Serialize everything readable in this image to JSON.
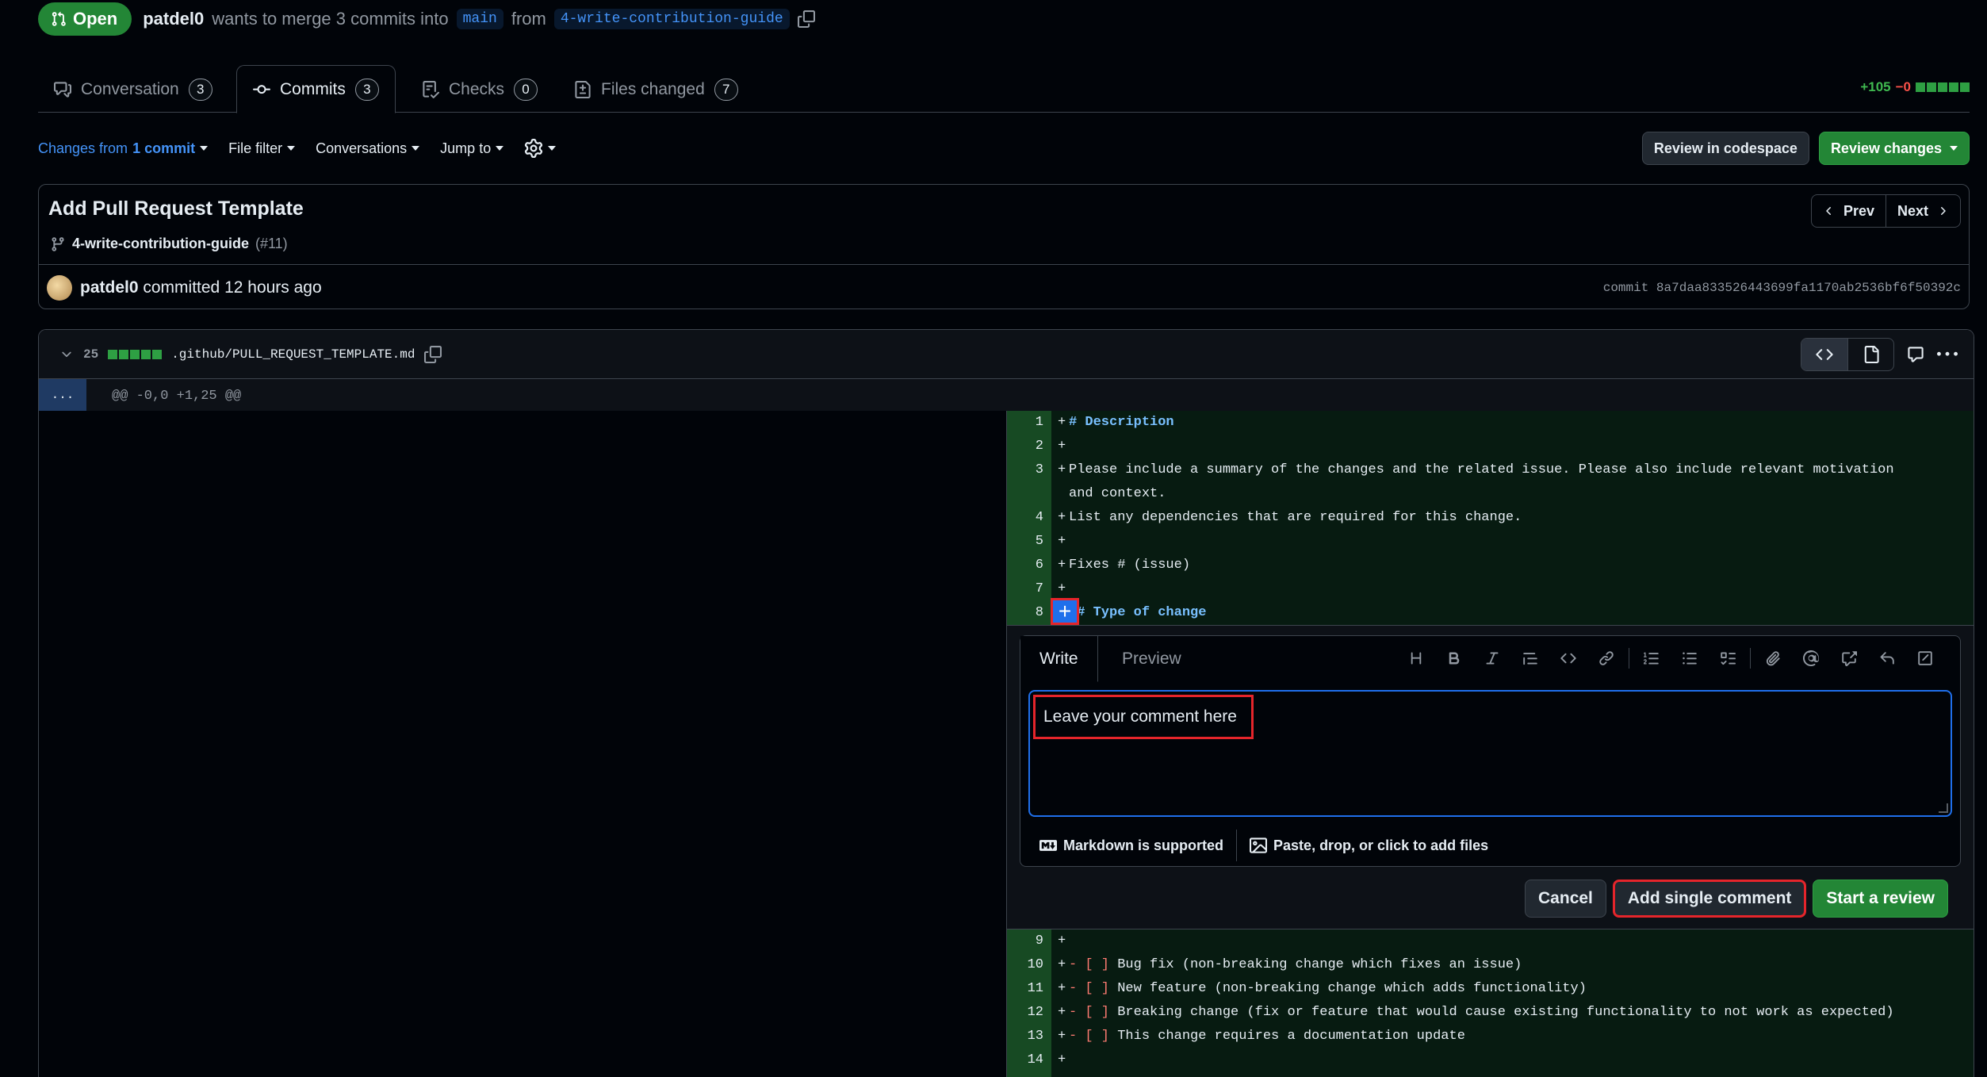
{
  "pr": {
    "state": "Open",
    "author": "patdel0",
    "merge_text": "wants to merge 3 commits into",
    "base": "main",
    "from_text": "from",
    "head": "4-write-contribution-guide"
  },
  "tabs": [
    {
      "label": "Conversation",
      "count": "3"
    },
    {
      "label": "Commits",
      "count": "3"
    },
    {
      "label": "Checks",
      "count": "0"
    },
    {
      "label": "Files changed",
      "count": "7"
    }
  ],
  "diffstat": {
    "additions": "+105",
    "deletions": "−0"
  },
  "toolbar": {
    "changes_from": "Changes from",
    "commit_count": "1 commit",
    "file_filter": "File filter",
    "conversations": "Conversations",
    "jump_to": "Jump to",
    "review_codespace": "Review in codespace",
    "review_changes": "Review changes"
  },
  "commit": {
    "title": "Add Pull Request Template",
    "branch": "4-write-contribution-guide",
    "pr_ref": "(#11)",
    "prev": "Prev",
    "next": "Next",
    "author": "patdel0",
    "committed": "committed 12 hours ago",
    "sha_label": "commit 8a7daa833526443699fa1170ab2536bf6f50392c"
  },
  "file": {
    "change_count": "25",
    "filename": ".github/PULL_REQUEST_TEMPLATE.md",
    "hunk_expand": "...",
    "hunk_header": "@@ -0,0 +1,25 @@"
  },
  "lines_top": [
    {
      "num": "1",
      "text": "# Description",
      "heading": true
    },
    {
      "num": "2",
      "text": ""
    },
    {
      "num": "3",
      "text": "Please include a summary of the changes and the related issue. Please also include relevant motivation and context."
    },
    {
      "num": "4",
      "text": "List any dependencies that are required for this change."
    },
    {
      "num": "5",
      "text": ""
    },
    {
      "num": "6",
      "text": "Fixes # (issue)"
    },
    {
      "num": "7",
      "text": ""
    },
    {
      "num": "8",
      "text": "## Type of change",
      "heading": true
    }
  ],
  "lines_bottom": [
    {
      "num": "9",
      "text": ""
    },
    {
      "num": "10",
      "text": "Bug fix (non-breaking change which fixes an issue)"
    },
    {
      "num": "11",
      "text": "New feature (non-breaking change which adds functionality)"
    },
    {
      "num": "12",
      "text": "Breaking change (fix or feature that would cause existing functionality to not work as expected)"
    },
    {
      "num": "13",
      "text": "This change requires a documentation update"
    },
    {
      "num": "14",
      "text": ""
    }
  ],
  "checkbox_prefix": "- [ ]",
  "comment_form": {
    "write_tab": "Write",
    "preview_tab": "Preview",
    "textarea_value": "Leave your comment here",
    "markdown_note": "Markdown is supported",
    "files_note": "Paste, drop, or click to add files",
    "cancel": "Cancel",
    "add_single": "Add single comment",
    "start_review": "Start a review"
  },
  "colors": {
    "accent": "#1f6feb",
    "success": "#238636",
    "highlight": "#e5252b",
    "background": "#010409"
  }
}
